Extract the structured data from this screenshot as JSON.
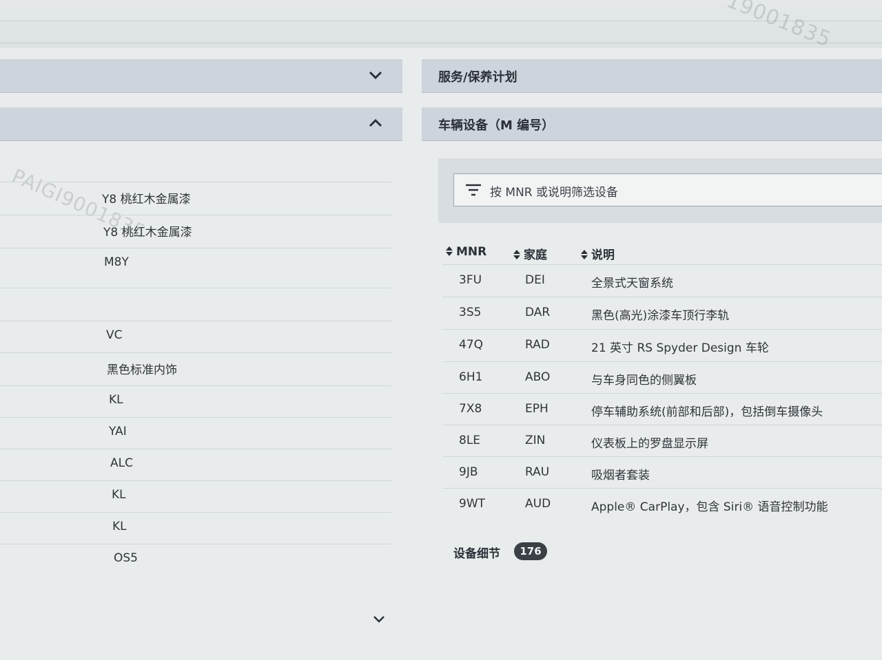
{
  "watermark": {
    "top_right": "19001835",
    "left": "PAIGI9001835"
  },
  "left_panel": {
    "values": [
      "Y8 桃红木金属漆",
      "Y8 桃红木金属漆",
      "M8Y",
      "",
      "VC",
      "黑色标准内饰",
      "KL",
      "YAI",
      "ALC",
      "KL",
      "KL",
      "OS5"
    ]
  },
  "right_panel": {
    "service_section_title": "服务/保养计划",
    "equipment_section_title": "车辆设备（M 编号）",
    "filter_placeholder": "按 MNR 或说明筛选设备",
    "table": {
      "headers": [
        "MNR",
        "家庭",
        "说明"
      ],
      "rows": [
        {
          "mnr": "3FU",
          "family": "DEI",
          "desc": "全景式天窗系统"
        },
        {
          "mnr": "3S5",
          "family": "DAR",
          "desc": "黑色(高光)涂漆车顶行李轨"
        },
        {
          "mnr": "47Q",
          "family": "RAD",
          "desc": "21 英寸 RS Spyder Design 车轮"
        },
        {
          "mnr": "6H1",
          "family": "ABO",
          "desc": "与车身同色的侧翼板"
        },
        {
          "mnr": "7X8",
          "family": "EPH",
          "desc": "停车辅助系统(前部和后部)，包括倒车摄像头"
        },
        {
          "mnr": "8LE",
          "family": "ZIN",
          "desc": "仪表板上的罗盘显示屏"
        },
        {
          "mnr": "9JB",
          "family": "RAU",
          "desc": "吸烟者套装"
        },
        {
          "mnr": "9WT",
          "family": "AUD",
          "desc": "Apple® CarPlay，包含 Siri® 语音控制功能"
        }
      ]
    },
    "details_label": "设备细节",
    "details_count": "176"
  },
  "icons": {
    "collapse": "chevron-down-icon",
    "expand": "chevron-up-icon",
    "filter": "filter-icon",
    "sort": "sort-icon"
  }
}
